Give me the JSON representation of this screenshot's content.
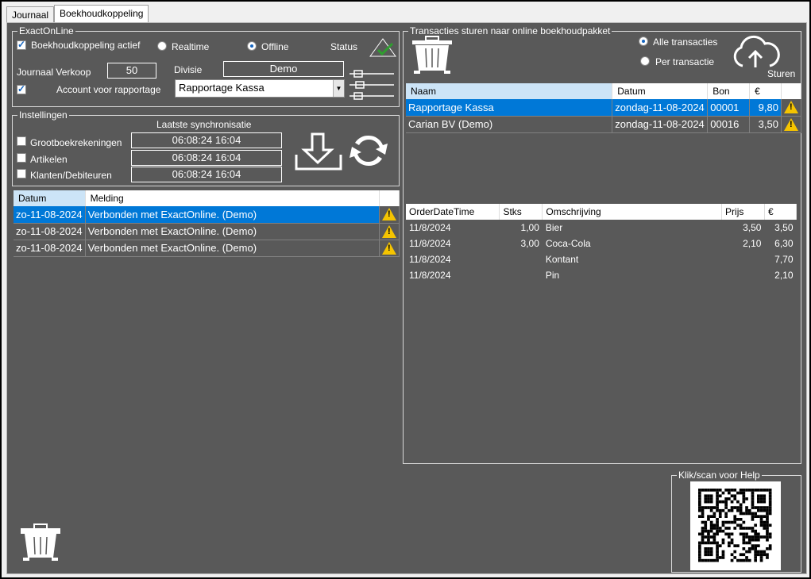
{
  "tabs": [
    {
      "label": "Journaal"
    },
    {
      "label": "Boekhoudkoppeling"
    }
  ],
  "exact": {
    "legend": "ExactOnLine",
    "active_label": "Boekhoudkoppeling actief",
    "realtime_label": "Realtime",
    "offline_label": "Offline",
    "status_label": "Status",
    "journaal_label": "Journaal Verkoop",
    "journaal_value": "50",
    "divisie_label": "Divisie",
    "divisie_value": "Demo",
    "account_label": "Account voor rapportage",
    "account_value": "Rapportage Kassa"
  },
  "instellingen": {
    "legend": "Instellingen",
    "sync_header": "Laatste synchronisatie",
    "rows": [
      {
        "label": "Grootboekrekeningen",
        "value": "06:08:24 16:04"
      },
      {
        "label": "Artikelen",
        "value": "06:08:24 16:04"
      },
      {
        "label": "Klanten/Debiteuren",
        "value": "06:08:24 16:04"
      }
    ]
  },
  "log": {
    "columns": [
      "Datum",
      "Melding"
    ],
    "rows": [
      {
        "datum": "zo-11-08-2024",
        "melding": "Verbonden met ExactOnline. (Demo)"
      },
      {
        "datum": "zo-11-08-2024",
        "melding": "Verbonden met ExactOnline. (Demo)"
      },
      {
        "datum": "zo-11-08-2024",
        "melding": "Verbonden met ExactOnline. (Demo)"
      }
    ]
  },
  "transacties": {
    "legend": "Transacties sturen  naar online boekhoudpakket",
    "alle_label": "Alle transacties",
    "per_label": "Per transactie",
    "sturen_label": "Sturen",
    "columns": [
      "Naam",
      "Datum",
      "Bon",
      "€"
    ],
    "rows": [
      {
        "naam": "Rapportage Kassa",
        "datum": "zondag-11-08-2024",
        "bon": "00001",
        "bedrag": "9,80"
      },
      {
        "naam": "Carian BV (Demo)",
        "datum": "zondag-11-08-2024",
        "bon": "00016",
        "bedrag": "3,50"
      }
    ]
  },
  "orders": {
    "columns": [
      "OrderDateTime",
      "Stks",
      "Omschrijving",
      "Prijs",
      "€"
    ],
    "rows": [
      {
        "date": "11/8/2024",
        "stks": "1,00",
        "omschr": "Bier",
        "prijs": "3,50",
        "bedrag": "3,50"
      },
      {
        "date": "11/8/2024",
        "stks": "3,00",
        "omschr": "Coca-Cola",
        "prijs": "2,10",
        "bedrag": "6,30"
      },
      {
        "date": "11/8/2024",
        "stks": "",
        "omschr": "Kontant",
        "prijs": "",
        "bedrag": "7,70"
      },
      {
        "date": "11/8/2024",
        "stks": "",
        "omschr": "Pin",
        "prijs": "",
        "bedrag": "2,10"
      }
    ]
  },
  "help": {
    "legend": "Klik/scan voor Help"
  },
  "colors": {
    "pane": "#595959",
    "selection": "#0078d7",
    "warning": "#f5c400",
    "status_check": "#2e9e2e"
  }
}
